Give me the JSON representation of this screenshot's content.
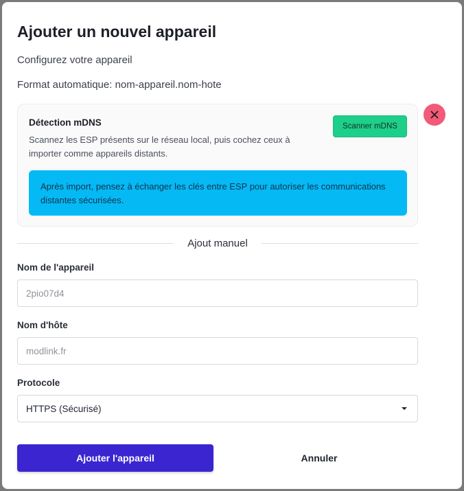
{
  "dialog": {
    "title": "Ajouter un nouvel appareil",
    "subtitle": "Configurez votre appareil",
    "format_hint": "Format automatique: nom-appareil.nom-hote"
  },
  "mdns": {
    "title": "Détection mDNS",
    "description": "Scannez les ESP présents sur le réseau local, puis cochez ceux à importer comme appareils distants.",
    "scan_label": "Scanner mDNS",
    "info": "Après import, pensez à échanger les clés entre ESP pour autoriser les communications distantes sécurisées."
  },
  "manual": {
    "divider_label": "Ajout manuel"
  },
  "fields": {
    "device_name": {
      "label": "Nom de l'appareil",
      "placeholder": "2pio07d4",
      "value": ""
    },
    "hostname": {
      "label": "Nom d'hôte",
      "placeholder": "modlink.fr",
      "value": ""
    },
    "protocol": {
      "label": "Protocole",
      "value": "HTTPS (Sécurisé)"
    }
  },
  "actions": {
    "submit_label": "Ajouter l'appareil",
    "cancel_label": "Annuler"
  },
  "icons": {
    "close": "close-icon",
    "dropdown": "chevron-down-icon"
  },
  "colors": {
    "primary": "#3b25d0",
    "scan": "#1ecf8a",
    "info": "#05b9f5",
    "close": "#f25a78"
  }
}
